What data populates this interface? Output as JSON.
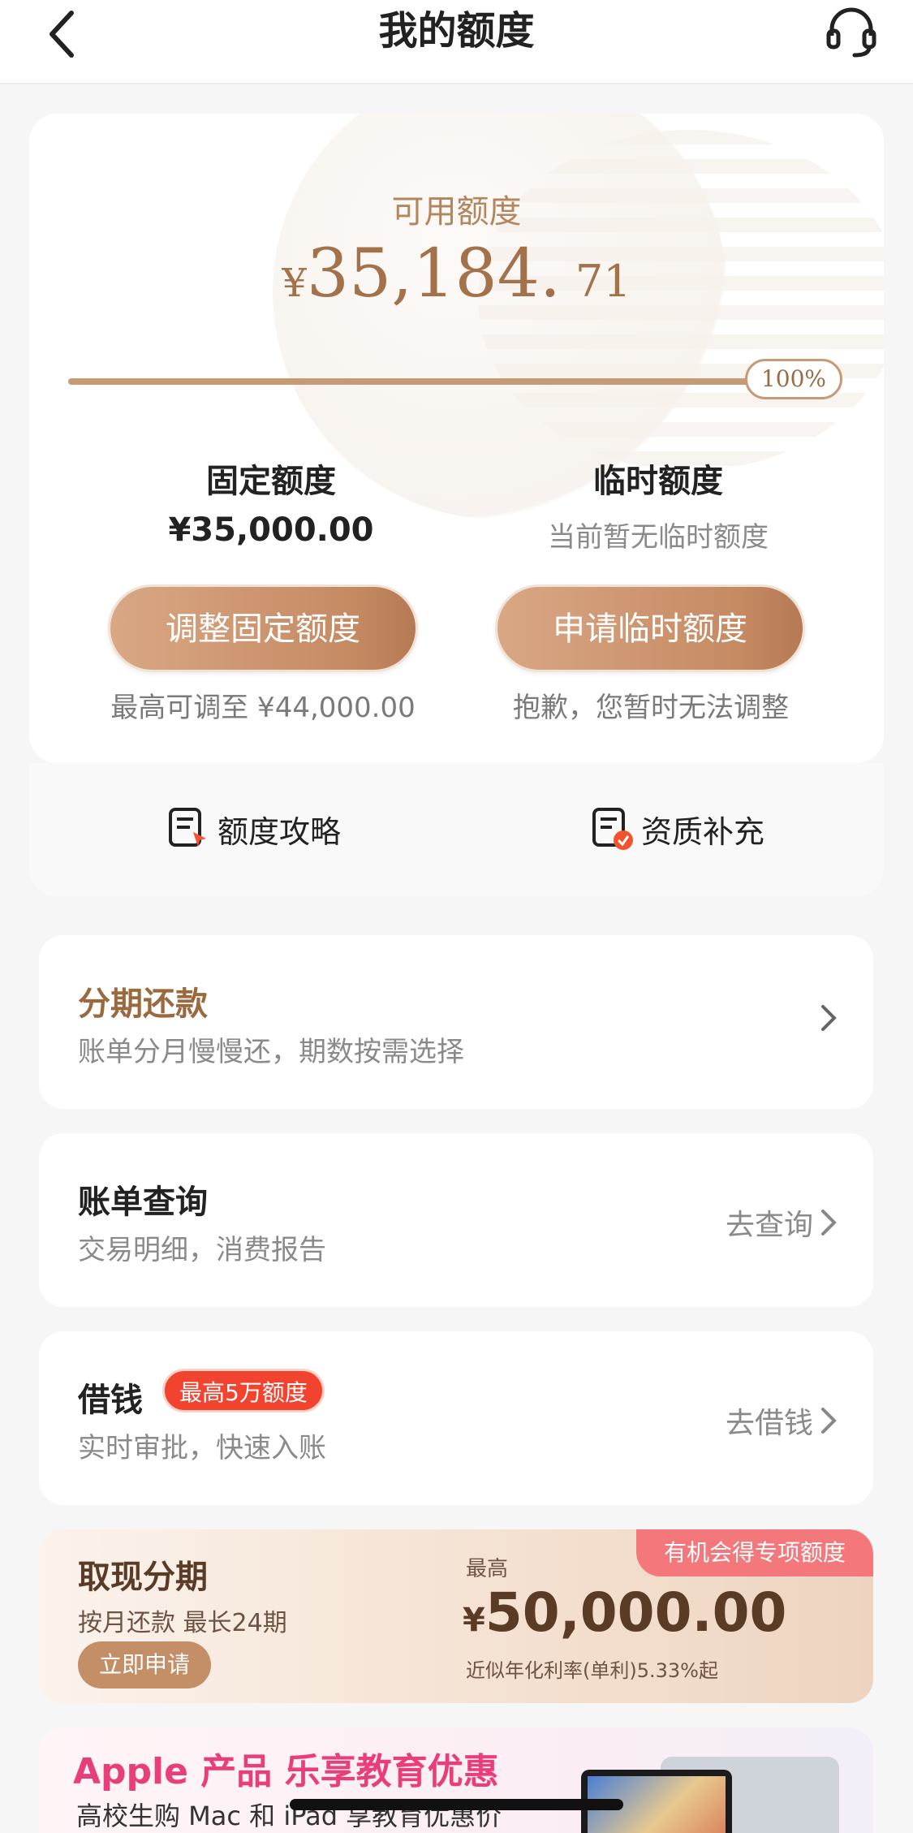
{
  "header": {
    "title": "我的额度",
    "back_icon": "chevron-left-icon",
    "service_icon": "headset-icon"
  },
  "credit": {
    "available_label": "可用额度",
    "currency": "¥",
    "available_int": "35,184.",
    "available_dec": "71",
    "progress_percent": 100,
    "progress_label": "100%",
    "fixed": {
      "title": "固定额度",
      "value": "¥35,000.00",
      "button": "调整固定额度",
      "hint": "最高可调至 ¥44,000.00"
    },
    "temp": {
      "title": "临时额度",
      "value": "当前暂无临时额度",
      "button": "申请临时额度",
      "hint": "抱歉，您暂时无法调整"
    }
  },
  "links": [
    {
      "label": "额度攻略",
      "icon": "guide-doc-icon"
    },
    {
      "label": "资质补充",
      "icon": "qualification-doc-icon"
    }
  ],
  "menu": {
    "installment": {
      "title": "分期还款",
      "sub": "账单分月慢慢还，期数按需选择"
    },
    "bill": {
      "title": "账单查询",
      "sub": "交易明细，消费报告",
      "action": "去查询"
    },
    "borrow": {
      "title": "借钱",
      "badge": "最高5万额度",
      "sub": "实时审批，快速入账",
      "action": "去借钱"
    }
  },
  "cash": {
    "title": "取现分期",
    "sub": "按月还款 最长24期",
    "button": "立即申请",
    "high_label": "最高",
    "currency": "¥",
    "amount": "50,000.00",
    "rate": "近似年化利率(单利)5.33%起",
    "tag": "有机会得专项额度"
  },
  "apple": {
    "title": "Apple 产品 乐享教育优惠",
    "sub": "高校生购 Mac 和 iPad 享教育优惠价"
  },
  "colors": {
    "accent": "#c48e66",
    "brand_text": "#a3714a",
    "badge_red": "#f2432e",
    "apple_pink": "#e83e7a"
  }
}
